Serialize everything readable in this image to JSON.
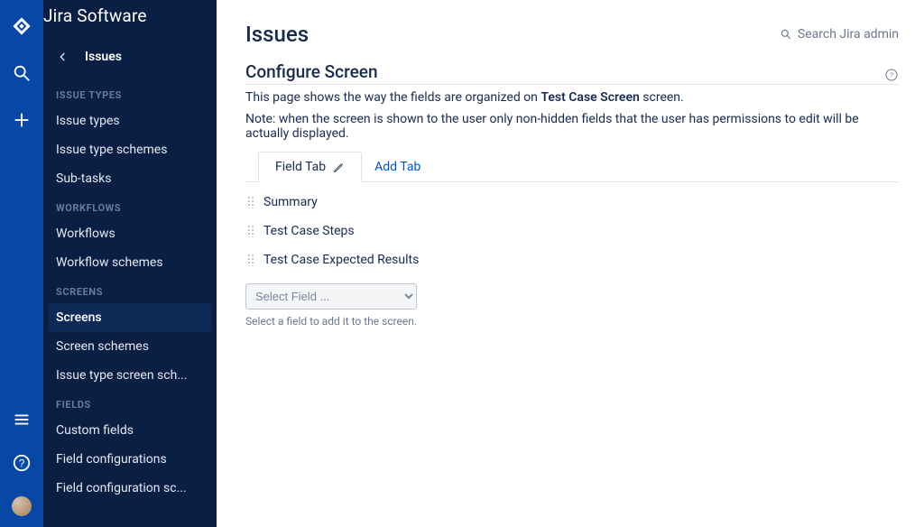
{
  "app": {
    "name": "Jira Software"
  },
  "rail_icons": {
    "logo": "jira-logo-icon",
    "search": "search-icon",
    "create": "plus-icon",
    "menu": "menu-icon",
    "help": "help-icon",
    "avatar": "avatar"
  },
  "sidebar": {
    "back_label": "Issues",
    "sections": [
      {
        "heading": "ISSUE TYPES",
        "items": [
          "Issue types",
          "Issue type schemes",
          "Sub-tasks"
        ]
      },
      {
        "heading": "WORKFLOWS",
        "items": [
          "Workflows",
          "Workflow schemes"
        ]
      },
      {
        "heading": "SCREENS",
        "items": [
          "Screens",
          "Screen schemes",
          "Issue type screen sch..."
        ]
      },
      {
        "heading": "FIELDS",
        "items": [
          "Custom fields",
          "Field configurations",
          "Field configuration sc..."
        ]
      }
    ],
    "active": "Screens"
  },
  "header": {
    "title": "Issues",
    "search_label": "Search Jira admin"
  },
  "screen": {
    "subtitle": "Configure Screen",
    "desc_prefix": "This page shows the way the fields are organized on ",
    "desc_bold": "Test Case Screen",
    "desc_suffix": " screen.",
    "note": "Note: when the screen is shown to the user only non-hidden fields that the user has permissions to edit will be actually displayed.",
    "tab_label": "Field Tab",
    "add_tab_label": "Add Tab",
    "fields": [
      "Summary",
      "Test Case Steps",
      "Test Case Expected Results"
    ],
    "select_placeholder": "Select Field ...",
    "select_hint": "Select a field to add it to the screen."
  }
}
